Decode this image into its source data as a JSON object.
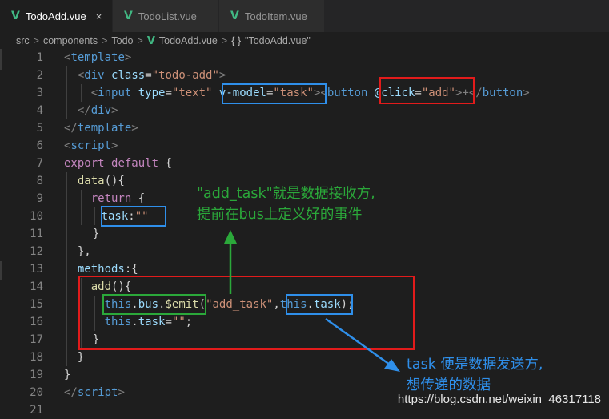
{
  "tabs": [
    {
      "label": "TodoAdd.vue",
      "icon": "vue-icon",
      "active": true,
      "close": "×"
    },
    {
      "label": "TodoList.vue",
      "icon": "vue-icon",
      "active": false
    },
    {
      "label": "TodoItem.vue",
      "icon": "vue-icon",
      "active": false
    }
  ],
  "breadcrumb": {
    "items": [
      "src",
      "components",
      "Todo",
      "TodoAdd.vue"
    ],
    "separator": ">",
    "symbol_icon": "{ }",
    "symbol": "\"TodoAdd.vue\""
  },
  "code": {
    "line_numbers": [
      "1",
      "2",
      "3",
      "4",
      "5",
      "6",
      "7",
      "8",
      "9",
      "10",
      "11",
      "12",
      "13",
      "14",
      "15",
      "16",
      "17",
      "18",
      "19",
      "20",
      "21"
    ],
    "tokens": {
      "l1": [
        "<",
        "template",
        ">"
      ],
      "l2": [
        "  ",
        "<",
        "div",
        " ",
        "class",
        "=",
        "\"todo-add\"",
        ">"
      ],
      "l3": [
        "    ",
        "<",
        "input",
        " ",
        "type",
        "=",
        "\"text\"",
        " ",
        "v-model",
        "=",
        "\"task\"",
        "><",
        "button",
        " ",
        "@click",
        "=",
        "\"add\"",
        ">+</",
        "button",
        ">"
      ],
      "l4": [
        "  ",
        "</",
        "div",
        ">"
      ],
      "l5": [
        "</",
        "template",
        ">"
      ],
      "l6": [
        "<",
        "script",
        ">"
      ],
      "l7": [
        "export",
        " ",
        "default",
        " {"
      ],
      "l8": [
        "  ",
        "data",
        "(){"
      ],
      "l9": [
        "    ",
        "return",
        " {"
      ],
      "l10": [
        "      ",
        "task",
        ":",
        "\"\""
      ],
      "l11": [
        "    }"
      ],
      "l12": [
        "  },"
      ],
      "l13": [
        "  ",
        "methods",
        ":{"
      ],
      "l14": [
        "    ",
        "add",
        "(){"
      ],
      "l15": [
        "      ",
        "this",
        ".",
        "bus",
        ".",
        "$emit",
        "(",
        "\"add_task\"",
        ",",
        "this",
        ".",
        "task",
        ");"
      ],
      "l16": [
        "      ",
        "this",
        ".",
        "task",
        "=",
        "\"\"",
        ";"
      ],
      "l17": [
        "    }"
      ],
      "l18": [
        "  }"
      ],
      "l19": [
        "}"
      ],
      "l20": [
        "</",
        "script",
        ">"
      ]
    }
  },
  "annotations": {
    "green_note_line1": "\"add_task\"就是数据接收方,",
    "green_note_line2": "提前在bus上定义好的事件",
    "blue_note_line1": "task 便是数据发送方,",
    "blue_note_line2": "想传递的数据"
  },
  "watermark": "https://blog.csdn.net/weixin_46317118",
  "colors": {
    "background": "#1e1e1e",
    "tag": "#569cd6",
    "attribute": "#9cdcfe",
    "string": "#ce9178",
    "keyword": "#c586c0",
    "function": "#dcdcaa",
    "highlight_red": "#e21b1b",
    "highlight_blue": "#2f8fea",
    "highlight_green": "#2ba83a"
  }
}
